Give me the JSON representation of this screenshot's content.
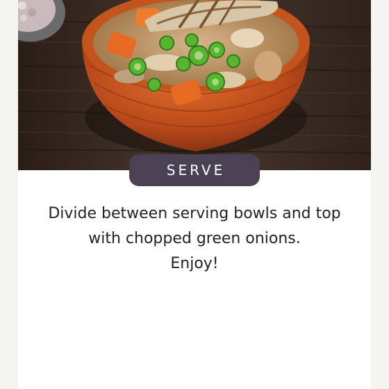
{
  "step": {
    "label": "SERVE"
  },
  "instructions": {
    "line1": "Divide between serving bowls and top",
    "line2": "with chopped green onions.",
    "line3": "Enjoy!"
  },
  "photo": {
    "icon": "soup-bowl-photo"
  },
  "colors": {
    "page_background": "#f3f5ee",
    "card_background": "#ffffff",
    "pill_background": "#4a4155",
    "text": "#222222"
  }
}
